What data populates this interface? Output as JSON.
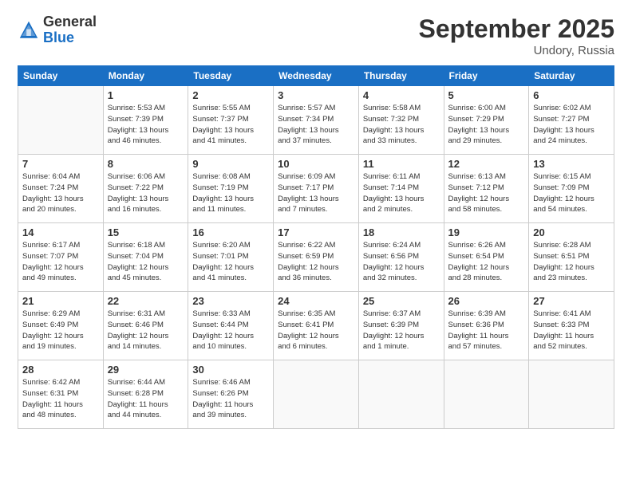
{
  "logo": {
    "general": "General",
    "blue": "Blue"
  },
  "title": "September 2025",
  "location": "Undory, Russia",
  "weekdays": [
    "Sunday",
    "Monday",
    "Tuesday",
    "Wednesday",
    "Thursday",
    "Friday",
    "Saturday"
  ],
  "weeks": [
    [
      {
        "day": "",
        "info": ""
      },
      {
        "day": "1",
        "info": "Sunrise: 5:53 AM\nSunset: 7:39 PM\nDaylight: 13 hours\nand 46 minutes."
      },
      {
        "day": "2",
        "info": "Sunrise: 5:55 AM\nSunset: 7:37 PM\nDaylight: 13 hours\nand 41 minutes."
      },
      {
        "day": "3",
        "info": "Sunrise: 5:57 AM\nSunset: 7:34 PM\nDaylight: 13 hours\nand 37 minutes."
      },
      {
        "day": "4",
        "info": "Sunrise: 5:58 AM\nSunset: 7:32 PM\nDaylight: 13 hours\nand 33 minutes."
      },
      {
        "day": "5",
        "info": "Sunrise: 6:00 AM\nSunset: 7:29 PM\nDaylight: 13 hours\nand 29 minutes."
      },
      {
        "day": "6",
        "info": "Sunrise: 6:02 AM\nSunset: 7:27 PM\nDaylight: 13 hours\nand 24 minutes."
      }
    ],
    [
      {
        "day": "7",
        "info": "Sunrise: 6:04 AM\nSunset: 7:24 PM\nDaylight: 13 hours\nand 20 minutes."
      },
      {
        "day": "8",
        "info": "Sunrise: 6:06 AM\nSunset: 7:22 PM\nDaylight: 13 hours\nand 16 minutes."
      },
      {
        "day": "9",
        "info": "Sunrise: 6:08 AM\nSunset: 7:19 PM\nDaylight: 13 hours\nand 11 minutes."
      },
      {
        "day": "10",
        "info": "Sunrise: 6:09 AM\nSunset: 7:17 PM\nDaylight: 13 hours\nand 7 minutes."
      },
      {
        "day": "11",
        "info": "Sunrise: 6:11 AM\nSunset: 7:14 PM\nDaylight: 13 hours\nand 2 minutes."
      },
      {
        "day": "12",
        "info": "Sunrise: 6:13 AM\nSunset: 7:12 PM\nDaylight: 12 hours\nand 58 minutes."
      },
      {
        "day": "13",
        "info": "Sunrise: 6:15 AM\nSunset: 7:09 PM\nDaylight: 12 hours\nand 54 minutes."
      }
    ],
    [
      {
        "day": "14",
        "info": "Sunrise: 6:17 AM\nSunset: 7:07 PM\nDaylight: 12 hours\nand 49 minutes."
      },
      {
        "day": "15",
        "info": "Sunrise: 6:18 AM\nSunset: 7:04 PM\nDaylight: 12 hours\nand 45 minutes."
      },
      {
        "day": "16",
        "info": "Sunrise: 6:20 AM\nSunset: 7:01 PM\nDaylight: 12 hours\nand 41 minutes."
      },
      {
        "day": "17",
        "info": "Sunrise: 6:22 AM\nSunset: 6:59 PM\nDaylight: 12 hours\nand 36 minutes."
      },
      {
        "day": "18",
        "info": "Sunrise: 6:24 AM\nSunset: 6:56 PM\nDaylight: 12 hours\nand 32 minutes."
      },
      {
        "day": "19",
        "info": "Sunrise: 6:26 AM\nSunset: 6:54 PM\nDaylight: 12 hours\nand 28 minutes."
      },
      {
        "day": "20",
        "info": "Sunrise: 6:28 AM\nSunset: 6:51 PM\nDaylight: 12 hours\nand 23 minutes."
      }
    ],
    [
      {
        "day": "21",
        "info": "Sunrise: 6:29 AM\nSunset: 6:49 PM\nDaylight: 12 hours\nand 19 minutes."
      },
      {
        "day": "22",
        "info": "Sunrise: 6:31 AM\nSunset: 6:46 PM\nDaylight: 12 hours\nand 14 minutes."
      },
      {
        "day": "23",
        "info": "Sunrise: 6:33 AM\nSunset: 6:44 PM\nDaylight: 12 hours\nand 10 minutes."
      },
      {
        "day": "24",
        "info": "Sunrise: 6:35 AM\nSunset: 6:41 PM\nDaylight: 12 hours\nand 6 minutes."
      },
      {
        "day": "25",
        "info": "Sunrise: 6:37 AM\nSunset: 6:39 PM\nDaylight: 12 hours\nand 1 minute."
      },
      {
        "day": "26",
        "info": "Sunrise: 6:39 AM\nSunset: 6:36 PM\nDaylight: 11 hours\nand 57 minutes."
      },
      {
        "day": "27",
        "info": "Sunrise: 6:41 AM\nSunset: 6:33 PM\nDaylight: 11 hours\nand 52 minutes."
      }
    ],
    [
      {
        "day": "28",
        "info": "Sunrise: 6:42 AM\nSunset: 6:31 PM\nDaylight: 11 hours\nand 48 minutes."
      },
      {
        "day": "29",
        "info": "Sunrise: 6:44 AM\nSunset: 6:28 PM\nDaylight: 11 hours\nand 44 minutes."
      },
      {
        "day": "30",
        "info": "Sunrise: 6:46 AM\nSunset: 6:26 PM\nDaylight: 11 hours\nand 39 minutes."
      },
      {
        "day": "",
        "info": ""
      },
      {
        "day": "",
        "info": ""
      },
      {
        "day": "",
        "info": ""
      },
      {
        "day": "",
        "info": ""
      }
    ]
  ]
}
